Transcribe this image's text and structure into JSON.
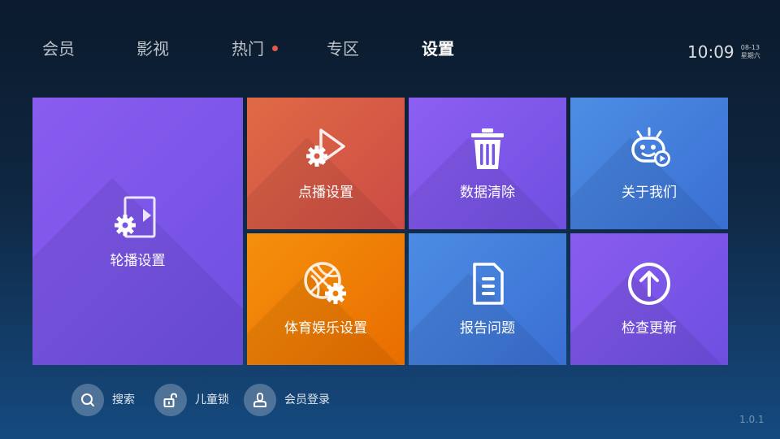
{
  "nav": {
    "tabs": [
      {
        "label": "会员"
      },
      {
        "label": "影视"
      },
      {
        "label": "热门"
      },
      {
        "label": "专区"
      },
      {
        "label": "设置"
      }
    ],
    "active_tab": "设置",
    "hot_dot_color": "#e8584a"
  },
  "clock": {
    "time": "10:09",
    "date": "08-13",
    "weekday": "星期六"
  },
  "tiles": {
    "carousel_settings": {
      "label": "轮播设置",
      "icon": "carousel-settings-icon",
      "color": "#7b55e8"
    },
    "vod_settings": {
      "label": "点播设置",
      "icon": "play-settings-icon",
      "color": "#d85a45"
    },
    "clear_data": {
      "label": "数据清除",
      "icon": "trash-icon",
      "color": "#7b55e8"
    },
    "about_us": {
      "label": "关于我们",
      "icon": "robot-face-icon",
      "color": "#437ddb"
    },
    "sports_settings": {
      "label": "体育娱乐设置",
      "icon": "basketball-settings-icon",
      "color": "#f08006"
    },
    "report_issue": {
      "label": "报告问题",
      "icon": "document-icon",
      "color": "#437ddb"
    },
    "check_update": {
      "label": "检查更新",
      "icon": "arrow-up-circle-icon",
      "color": "#7b55e8"
    }
  },
  "shortcuts": {
    "search": {
      "label": "搜索",
      "icon": "search-icon"
    },
    "child_lock": {
      "label": "儿童锁",
      "icon": "unlock-icon"
    },
    "member_login": {
      "label": "会员登录",
      "icon": "user-icon"
    }
  },
  "version": "1.0.1"
}
